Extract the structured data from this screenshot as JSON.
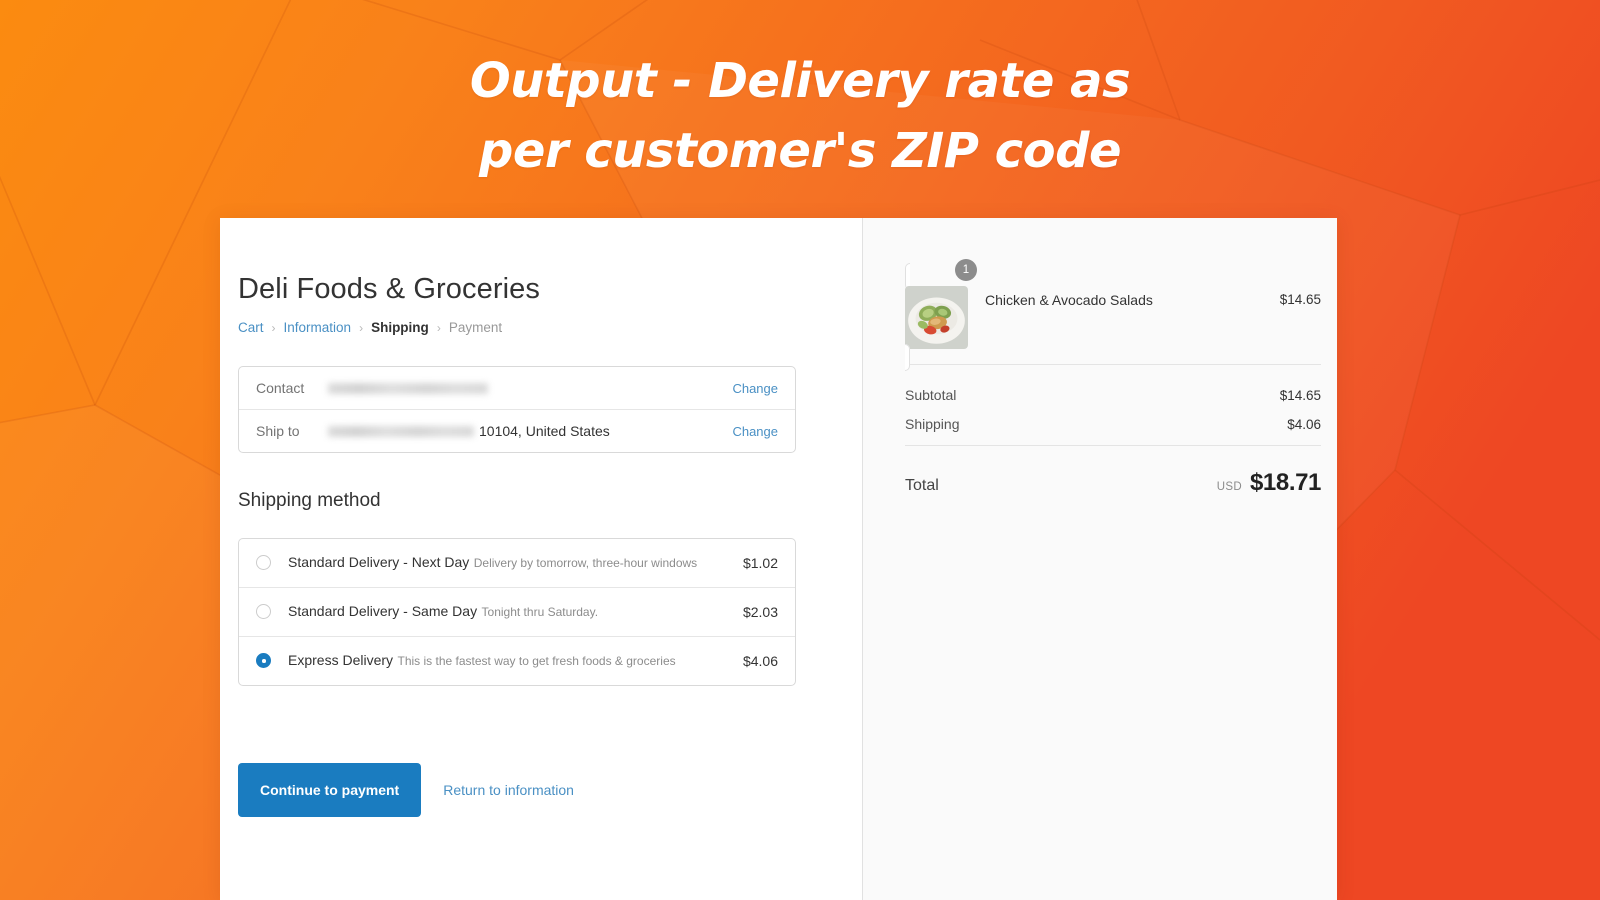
{
  "headline": {
    "line1": "Output - Delivery rate as",
    "line2": "per customer's ZIP code"
  },
  "colors": {
    "background_left": "#f9811a",
    "background_right": "#ef4823",
    "accent_blue": "#1a7cc0",
    "link_blue": "#4a90c4",
    "summary_bg": "#fafafa"
  },
  "checkout": {
    "shop_title": "Deli Foods & Groceries",
    "breadcrumb": [
      {
        "label": "Cart",
        "state": "link"
      },
      {
        "label": "Information",
        "state": "link"
      },
      {
        "label": "Shipping",
        "state": "current"
      },
      {
        "label": "Payment",
        "state": "next"
      }
    ],
    "breadcrumb_separator": "›",
    "info": {
      "contact": {
        "label": "Contact",
        "value": "",
        "redacted": true,
        "change_label": "Change"
      },
      "ship_to": {
        "label": "Ship to",
        "value_redacted": true,
        "value": "10104, United States",
        "change_label": "Change"
      }
    },
    "shipping_section_title": "Shipping method",
    "shipping_options": [
      {
        "name": "Standard Delivery - Next Day",
        "description": "Delivery by tomorrow, three-hour windows",
        "price": "$1.02",
        "selected": false
      },
      {
        "name": "Standard Delivery - Same Day",
        "description": "Tonight thru Saturday.",
        "price": "$2.03",
        "selected": false
      },
      {
        "name": "Express Delivery",
        "description": "This is the fastest way to get fresh foods & groceries",
        "price": "$4.06",
        "selected": true
      }
    ],
    "actions": {
      "primary_label": "Continue to payment",
      "secondary_label": "Return to information"
    }
  },
  "summary": {
    "item": {
      "name": "Chicken & Avocado Salads",
      "price": "$14.65",
      "quantity": "1",
      "thumbnail": "food-plate-image"
    },
    "rows": [
      {
        "label": "Subtotal",
        "value": "$14.65"
      },
      {
        "label": "Shipping",
        "value": "$4.06"
      }
    ],
    "total": {
      "label": "Total",
      "currency": "USD",
      "value": "$18.71"
    }
  }
}
